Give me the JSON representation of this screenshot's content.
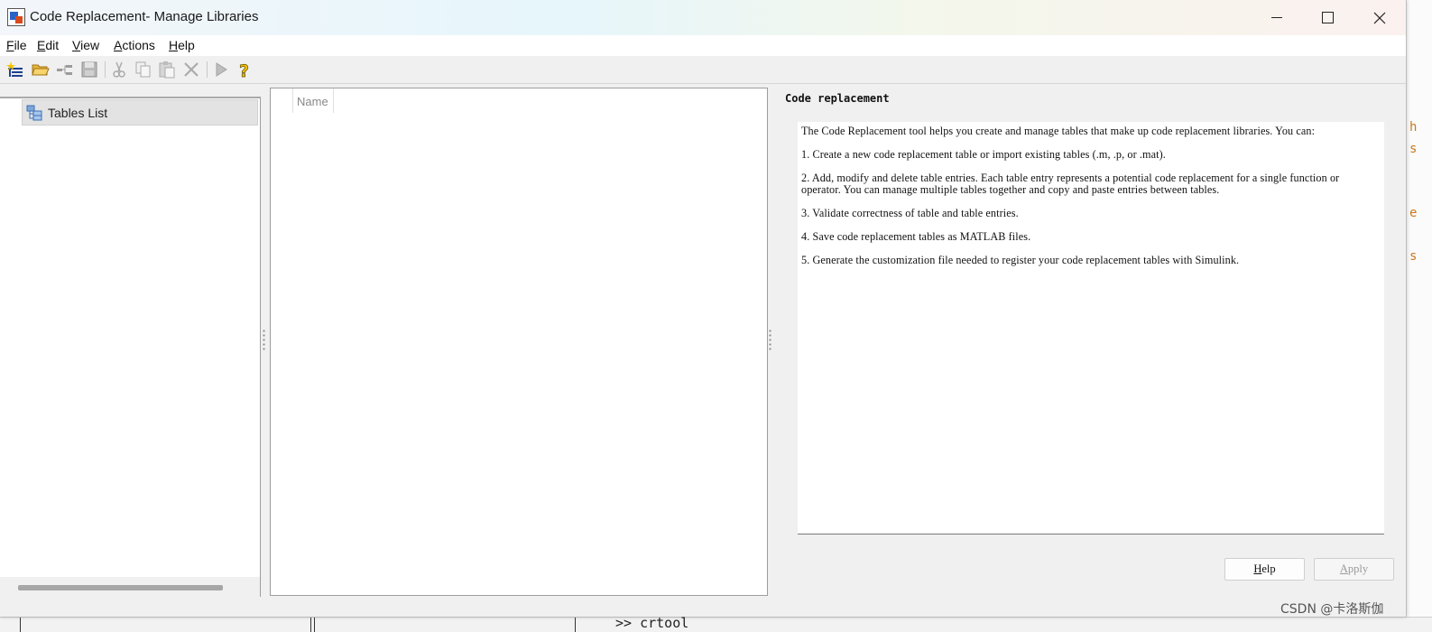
{
  "window": {
    "title": "Code Replacement- Manage Libraries"
  },
  "menu": {
    "items": [
      {
        "underline": "F",
        "rest": "ile"
      },
      {
        "underline": "E",
        "rest": "dit"
      },
      {
        "underline": "V",
        "rest": "iew"
      },
      {
        "underline": "A",
        "rest": "ctions"
      },
      {
        "underline": "H",
        "rest": "elp"
      }
    ]
  },
  "toolbar": {
    "icons": [
      "new-table-icon",
      "open-folder-icon",
      "tree-link-icon",
      "save-icon",
      "cut-icon",
      "copy-icon",
      "paste-icon",
      "delete-icon",
      "run-icon",
      "help-icon"
    ]
  },
  "tree": {
    "root_label": "Tables List"
  },
  "list": {
    "column_name": "Name"
  },
  "info": {
    "title": "Code replacement",
    "paragraphs": [
      "The Code Replacement tool helps you create and manage tables that make up code replacement libraries. You can:",
      "1. Create a new code replacement table or import existing tables (.m, .p, or .mat).",
      "2. Add, modify and delete table entries. Each table entry represents a potential code replacement for a single function or operator. You can manage multiple tables together and copy and paste entries between tables.",
      "3. Validate correctness of table and table entries.",
      "4. Save code replacement tables as MATLAB files.",
      "5. Generate the customization file needed to register your code replacement tables with Simulink."
    ]
  },
  "buttons": {
    "help_underline": "H",
    "help_rest": "elp",
    "apply_underline": "A",
    "apply_rest": "pply"
  },
  "background": {
    "command": ">> crtool",
    "right_chars": [
      "h",
      "s",
      "e",
      "s"
    ]
  },
  "watermark": "CSDN @卡洛斯伽"
}
